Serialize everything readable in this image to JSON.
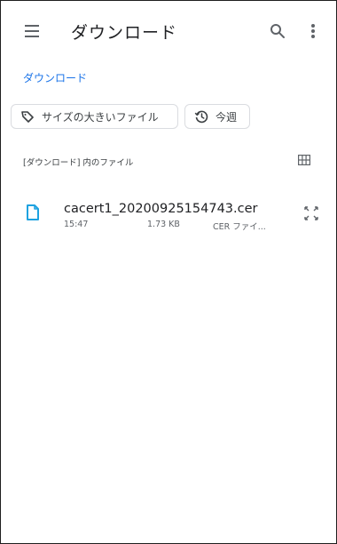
{
  "appbar": {
    "title": "ダウンロード",
    "menu_icon": "menu-icon",
    "search_icon": "search-icon",
    "more_icon": "more-vert-icon"
  },
  "breadcrumb": {
    "label": "ダウンロード"
  },
  "filters": [
    {
      "label": "サイズの大きいファイル",
      "icon": "label-tag-icon"
    },
    {
      "label": "今週",
      "icon": "history-icon"
    }
  ],
  "section": {
    "title": "[ダウンロード] 内のファイル",
    "view_toggle_icon": "grid-view-icon"
  },
  "files": [
    {
      "name": "cacert1_20200925154743.cer",
      "time": "15:47",
      "size": "1.73 KB",
      "type": "CER ファイ...",
      "icon": "file-icon",
      "action_icon": "expand-icon"
    }
  ],
  "colors": {
    "accent": "#1a73e8",
    "file_icon": "#1ea2e0",
    "text_secondary": "#5f6368"
  }
}
